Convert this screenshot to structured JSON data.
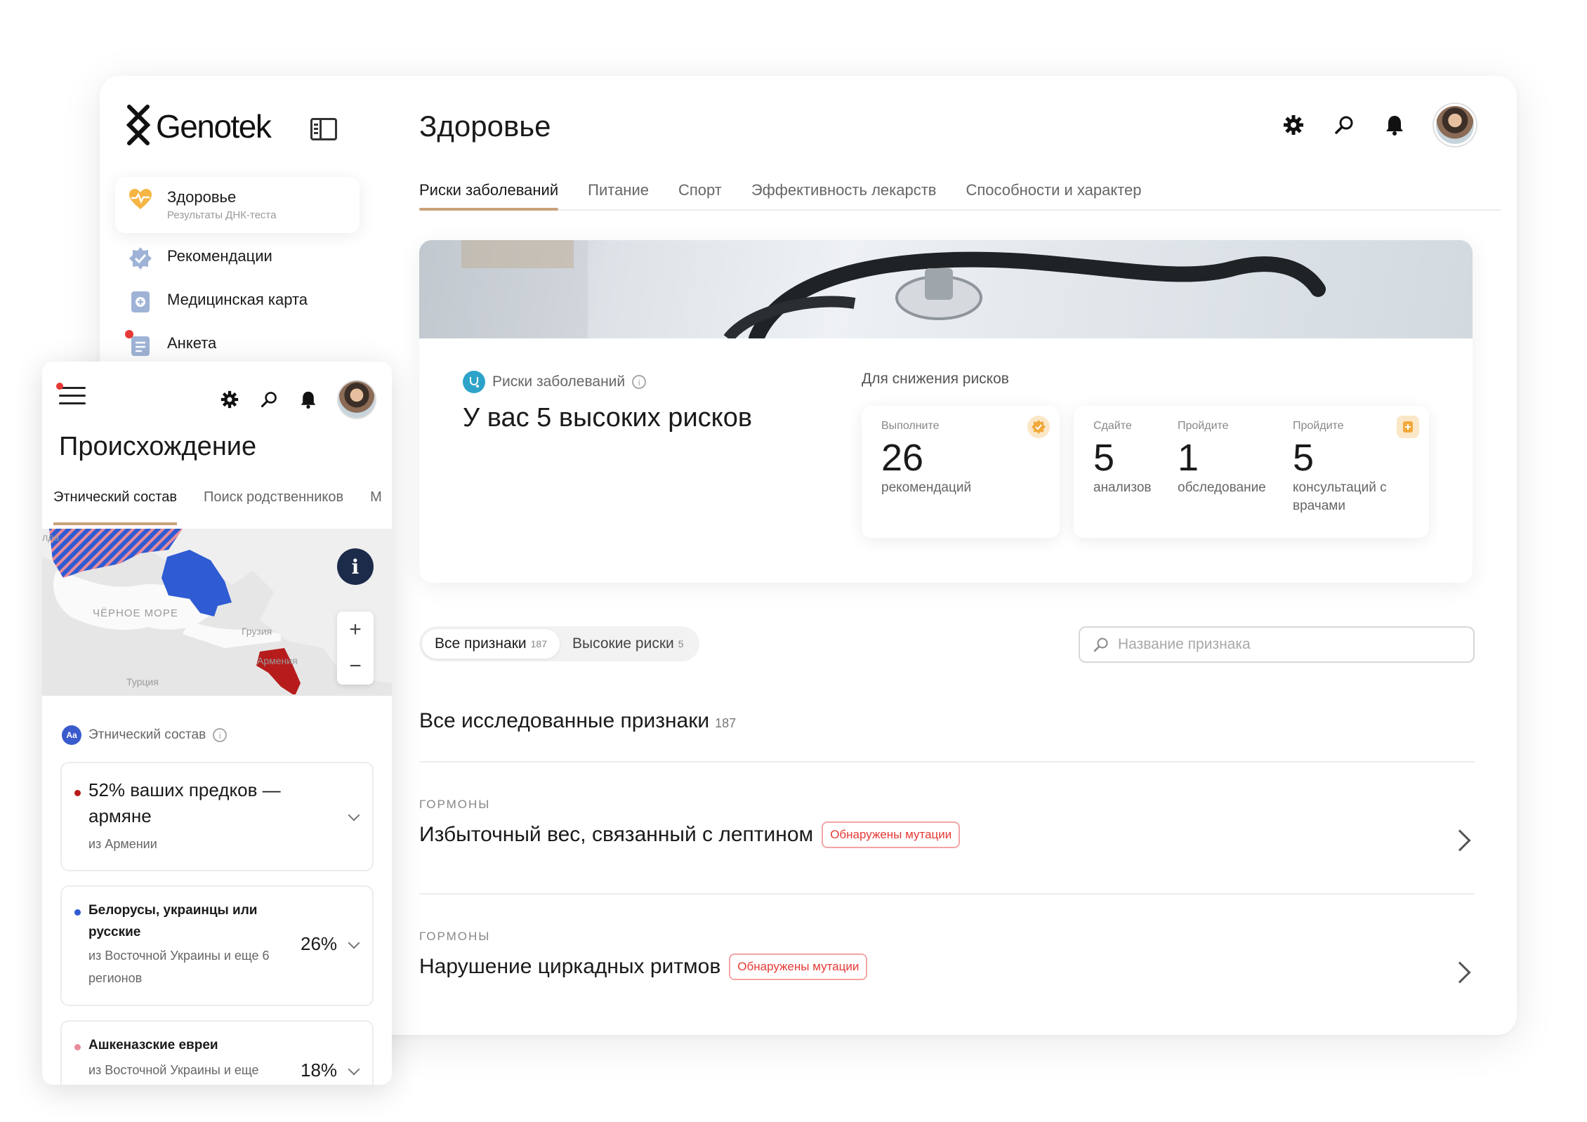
{
  "brand": {
    "name": "Genotek"
  },
  "sidebar": {
    "items": [
      {
        "label": "Здоровье",
        "sub": "Результаты ДНК-теста",
        "icon": "heart-pulse-icon",
        "active": true
      },
      {
        "label": "Рекомендации",
        "icon": "verified-badge-icon"
      },
      {
        "label": "Медицинская карта",
        "icon": "medical-card-icon"
      },
      {
        "label": "Анкета",
        "icon": "questionnaire-icon",
        "has_notification": true
      }
    ]
  },
  "header": {
    "title": "Здоровье",
    "icons": [
      "gear-icon",
      "search-icon",
      "bell-icon",
      "avatar"
    ]
  },
  "tabs": [
    {
      "label": "Риски заболеваний",
      "active": true
    },
    {
      "label": "Питание"
    },
    {
      "label": "Спорт"
    },
    {
      "label": "Эффективность лекарств"
    },
    {
      "label": "Способности и характер"
    }
  ],
  "hero": {
    "label": "Риски заболеваний",
    "title": "У вас 5 высоких рисков",
    "reduce_label": "Для снижения рисков",
    "card1": {
      "small": "Выполните",
      "num": "26",
      "desc": "рекомендаций"
    },
    "card2": {
      "cols": [
        {
          "small": "Сдайте",
          "num": "5",
          "desc": "анализов"
        },
        {
          "small": "Пройдите",
          "num": "1",
          "desc": "обследование"
        },
        {
          "small": "Пройдите",
          "num": "5",
          "desc": "консультаций с врачами"
        }
      ]
    }
  },
  "filters": [
    {
      "label": "Все признаки",
      "count": "187",
      "active": true
    },
    {
      "label": "Высокие риски",
      "count": "5"
    }
  ],
  "search": {
    "placeholder": "Название признака"
  },
  "section": {
    "title": "Все исследованные признаки",
    "count": "187"
  },
  "traits": [
    {
      "category": "ГОРМОНЫ",
      "name": "Избыточный вес, связанный с лептином",
      "badge": "Обнаружены мутации"
    },
    {
      "category": "ГОРМОНЫ",
      "name": "Нарушение циркадных ритмов",
      "badge": "Обнаружены мутации"
    }
  ],
  "mobile": {
    "title": "Происхождение",
    "tabs": [
      {
        "label": "Этнический состав",
        "active": true
      },
      {
        "label": "Поиск родственников"
      },
      {
        "label": "М"
      }
    ],
    "map": {
      "labels": {
        "sea": "ЧЁРНОЕ МОРЕ",
        "georgia": "Грузия",
        "turkey": "Турция",
        "armenia": "Армения",
        "clipped": "лда"
      },
      "zoom_in": "+",
      "zoom_out": "−",
      "info": "i"
    },
    "ethnic_header": "Этнический состав",
    "ethnic_badge": "Aa",
    "groups": [
      {
        "name": "52% ваших предков — армяне",
        "sub": "из Армении",
        "color": "#b71c1c"
      },
      {
        "name": "Белорусы, украинцы или русские",
        "sub": "из Восточной Украины и еще 6 регионов",
        "percent": "26%",
        "color": "#2f5bd3"
      },
      {
        "name": "Ашкеназские евреи",
        "sub": "из Восточной Украины и еще",
        "percent": "18%",
        "color": "#e88a9b"
      }
    ]
  },
  "colors": {
    "accent": "#c9a27a",
    "danger": "#e53935",
    "teal": "#2ea3c9",
    "orange_badge": "#f0a93b"
  }
}
